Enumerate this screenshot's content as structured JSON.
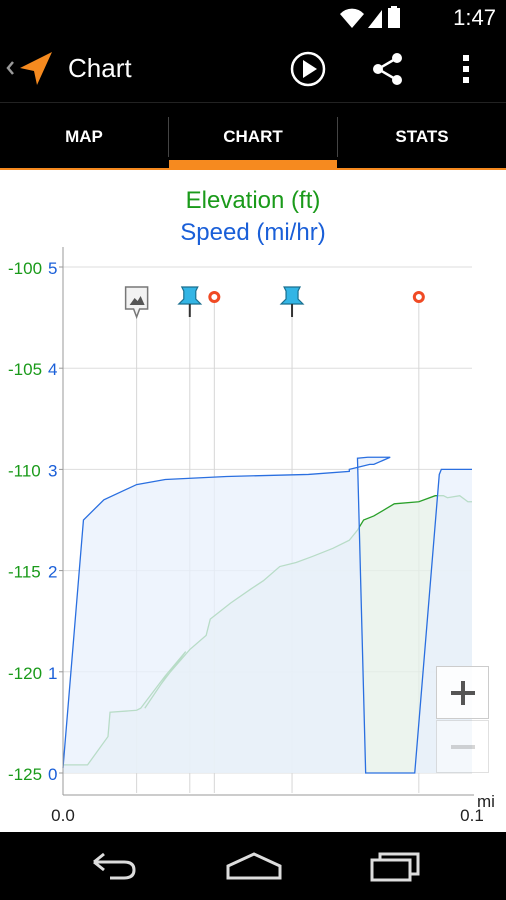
{
  "status_bar": {
    "time": "1:47"
  },
  "action_bar": {
    "title": "Chart"
  },
  "tabs": [
    {
      "label": "MAP",
      "selected": false
    },
    {
      "label": "CHART",
      "selected": true
    },
    {
      "label": "STATS",
      "selected": false
    }
  ],
  "chart_data": {
    "type": "line",
    "title": "Elevation (ft)",
    "subtitle": "Speed (mi/hr)",
    "xlabel": "mi",
    "x_tick_labels": [
      "0.0",
      "0.1"
    ],
    "xlim": [
      0.0,
      0.1
    ],
    "left_axis": {
      "ticks": [
        -100,
        -105,
        -110,
        -115,
        -120,
        -125
      ],
      "ylim": [
        -125,
        -100
      ],
      "color": "#1a9a1a"
    },
    "right_axis": {
      "ticks": [
        5,
        4,
        3,
        2,
        1,
        0
      ],
      "ylim": [
        0,
        5
      ],
      "color": "#1a5fd8"
    },
    "grid": true,
    "series": [
      {
        "name": "Elevation (ft)",
        "axis": "left",
        "color": "#2aa02a",
        "fill": "#e6f0e8",
        "points": [
          [
            0.0,
            -124.6
          ],
          [
            0.006,
            -124.6
          ],
          [
            0.011,
            -123.2
          ],
          [
            0.0115,
            -122.0
          ],
          [
            0.018,
            -121.9
          ],
          [
            0.019,
            -121.8
          ],
          [
            0.025,
            -120.2
          ],
          [
            0.03,
            -119.0
          ],
          [
            0.024,
            -120.6
          ],
          [
            0.02,
            -121.8
          ],
          [
            0.025,
            -120.3
          ],
          [
            0.031,
            -118.9
          ],
          [
            0.035,
            -118.2
          ],
          [
            0.036,
            -117.4
          ],
          [
            0.041,
            -116.6
          ],
          [
            0.046,
            -115.9
          ],
          [
            0.049,
            -115.5
          ],
          [
            0.053,
            -114.8
          ],
          [
            0.057,
            -114.6
          ],
          [
            0.061,
            -114.3
          ],
          [
            0.066,
            -113.9
          ],
          [
            0.07,
            -113.5
          ],
          [
            0.072,
            -113.0
          ],
          [
            0.0735,
            -112.5
          ],
          [
            0.076,
            -112.3
          ],
          [
            0.081,
            -111.7
          ],
          [
            0.087,
            -111.6
          ],
          [
            0.091,
            -111.3
          ],
          [
            0.093,
            -111.3
          ],
          [
            0.094,
            -111.4
          ],
          [
            0.097,
            -111.3
          ],
          [
            0.099,
            -111.6
          ],
          [
            0.1,
            -111.6
          ]
        ]
      },
      {
        "name": "Speed (mi/hr)",
        "axis": "right",
        "color": "#2a6fe0",
        "fill": "#e8f0fc",
        "points": [
          [
            0.0,
            0.05
          ],
          [
            0.005,
            2.5
          ],
          [
            0.01,
            2.7
          ],
          [
            0.018,
            2.85
          ],
          [
            0.025,
            2.9
          ],
          [
            0.04,
            2.93
          ],
          [
            0.06,
            2.95
          ],
          [
            0.07,
            2.98
          ],
          [
            0.07,
            3.0
          ],
          [
            0.075,
            3.05
          ],
          [
            0.076,
            3.05
          ],
          [
            0.08,
            3.12
          ],
          [
            0.0745,
            3.12
          ],
          [
            0.072,
            3.11
          ],
          [
            0.074,
            0.0
          ],
          [
            0.086,
            0.0
          ],
          [
            0.092,
            2.95
          ],
          [
            0.0925,
            3.0
          ],
          [
            0.1,
            3.0
          ]
        ]
      }
    ],
    "markers": [
      {
        "type": "photo",
        "x": 0.018
      },
      {
        "type": "pin",
        "x": 0.031
      },
      {
        "type": "waypoint",
        "x": 0.037
      },
      {
        "type": "pin",
        "x": 0.056
      },
      {
        "type": "waypoint",
        "x": 0.087
      }
    ]
  },
  "nav": {
    "back": "back-icon",
    "home": "home-icon",
    "recents": "recent-apps-icon"
  }
}
